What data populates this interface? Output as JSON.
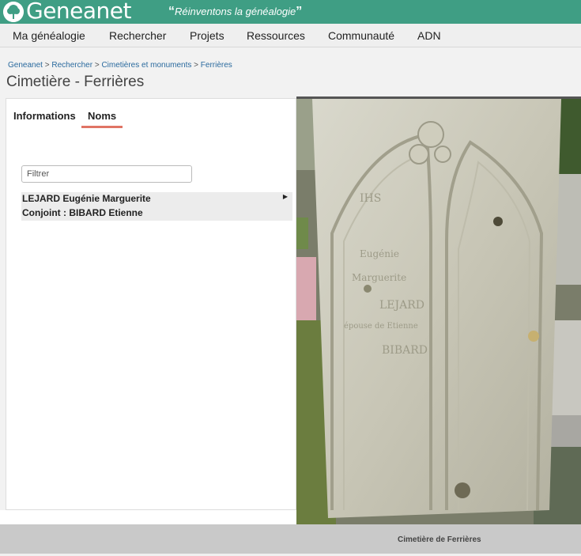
{
  "brand": {
    "name": "Geneanet",
    "tagline": "Réinventons la généalogie",
    "color": "#3f9e84"
  },
  "nav": {
    "items": [
      "Ma généalogie",
      "Rechercher",
      "Projets",
      "Ressources",
      "Communauté",
      "ADN"
    ]
  },
  "breadcrumb": [
    "Geneanet",
    "Rechercher",
    "Cimetières et monuments",
    "Ferrières"
  ],
  "page": {
    "title": "Cimetière - Ferrières"
  },
  "tabs": [
    {
      "label": "Informations",
      "active": false
    },
    {
      "label": "Noms",
      "active": true
    }
  ],
  "filter": {
    "placeholder": "Filtrer",
    "value": ""
  },
  "results": [
    {
      "name": "LEJARD Eugénie Marguerite",
      "spouse": "Conjoint : BIBARD Etienne"
    }
  ],
  "photo": {
    "caption": "Cimetière de Ferrières",
    "engraving": [
      "IHS",
      "Eugénie",
      "Marguerite",
      "LEJARD",
      "épouse de Etienne",
      "BIBARD"
    ]
  },
  "colors": {
    "accent_underline": "#e07465",
    "link": "#2a6a9e"
  }
}
